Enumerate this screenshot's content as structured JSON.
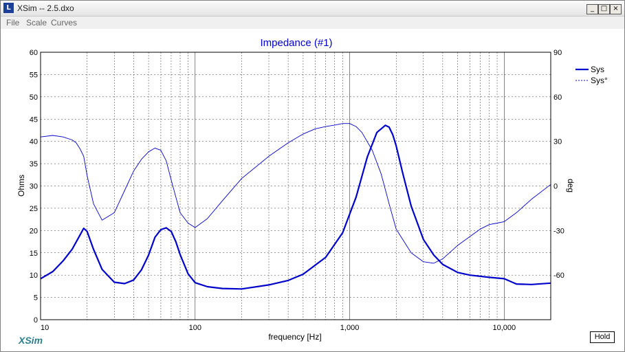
{
  "window": {
    "title": "XSim -- 2.5.dxo",
    "icon": "xsim-app-icon",
    "controls": {
      "minimize": "_",
      "maximize": "□",
      "close": "×"
    }
  },
  "menu": {
    "items": [
      "File",
      "Scale",
      "Curves"
    ]
  },
  "logo": "XSim",
  "hold_label": "Hold",
  "colors": {
    "curve": "#0000cc",
    "plot_bg": "#ffffff",
    "chrome": "#f0f0f0"
  },
  "chart_data": {
    "type": "line",
    "title": "Impedance (#1)",
    "xlabel": "frequency [Hz]",
    "ylabel": "Ohms",
    "y2label": "deg",
    "xscale": "log",
    "xlim": [
      10,
      20000
    ],
    "ylim": [
      0,
      60
    ],
    "y2lim": [
      -90,
      90
    ],
    "x_tick_labels": [
      "10",
      "100",
      "1,000",
      "10,000"
    ],
    "y_tick_labels": [
      "0",
      "5",
      "10",
      "15",
      "20",
      "25",
      "30",
      "35",
      "40",
      "45",
      "50",
      "55",
      "60"
    ],
    "y2_tick_labels": [
      "90",
      "60",
      "30",
      "0",
      "-30",
      "-60"
    ],
    "legend_position": "top-right",
    "grid": true,
    "series": [
      {
        "name": "Sys",
        "axis": "left",
        "x": [
          10,
          12,
          14,
          16,
          18,
          19,
          20,
          22,
          25,
          30,
          35,
          40,
          45,
          50,
          55,
          60,
          65,
          70,
          75,
          80,
          90,
          100,
          120,
          150,
          200,
          300,
          400,
          500,
          700,
          900,
          1100,
          1300,
          1500,
          1700,
          1800,
          1900,
          2000,
          2200,
          2500,
          3000,
          3500,
          4000,
          5000,
          6000,
          8000,
          10000,
          12000,
          15000,
          20000
        ],
        "values": [
          9.2,
          10.8,
          13.2,
          15.8,
          19.0,
          20.5,
          19.8,
          15.8,
          11.3,
          8.4,
          8.1,
          8.9,
          11.2,
          14.5,
          18.5,
          20.2,
          20.6,
          19.8,
          17.5,
          14.6,
          10.3,
          8.3,
          7.4,
          7.0,
          6.9,
          7.8,
          8.8,
          10.2,
          14.0,
          19.5,
          27.5,
          36.5,
          42.0,
          43.6,
          43.2,
          41.5,
          39.0,
          33.0,
          25.5,
          18.0,
          14.5,
          12.4,
          10.6,
          10.0,
          9.5,
          9.2,
          8.0,
          7.9,
          8.2
        ]
      },
      {
        "name": "Sys°",
        "axis": "right",
        "x": [
          10,
          12,
          14,
          16,
          17,
          18,
          19,
          20,
          22,
          25,
          30,
          35,
          40,
          45,
          50,
          55,
          60,
          65,
          70,
          80,
          90,
          100,
          120,
          150,
          200,
          300,
          400,
          500,
          600,
          700,
          800,
          900,
          1000,
          1100,
          1200,
          1400,
          1600,
          1800,
          2000,
          2500,
          3000,
          3500,
          4000,
          5000,
          6000,
          7000,
          8000,
          9000,
          10000,
          12000,
          15000,
          20000
        ],
        "values": [
          33,
          34,
          33,
          31,
          29,
          25,
          20,
          7,
          -12,
          -23,
          -18,
          -3,
          10,
          18,
          23,
          25.5,
          24,
          17,
          4,
          -18,
          -25,
          -28,
          -22,
          -10,
          5,
          20,
          29,
          35,
          38.5,
          40,
          41,
          42,
          42,
          40,
          36,
          24,
          8,
          -12,
          -29,
          -45,
          -51,
          -52,
          -49,
          -40,
          -34,
          -29,
          -26,
          -25,
          -24,
          -18,
          -9,
          1
        ]
      }
    ]
  }
}
